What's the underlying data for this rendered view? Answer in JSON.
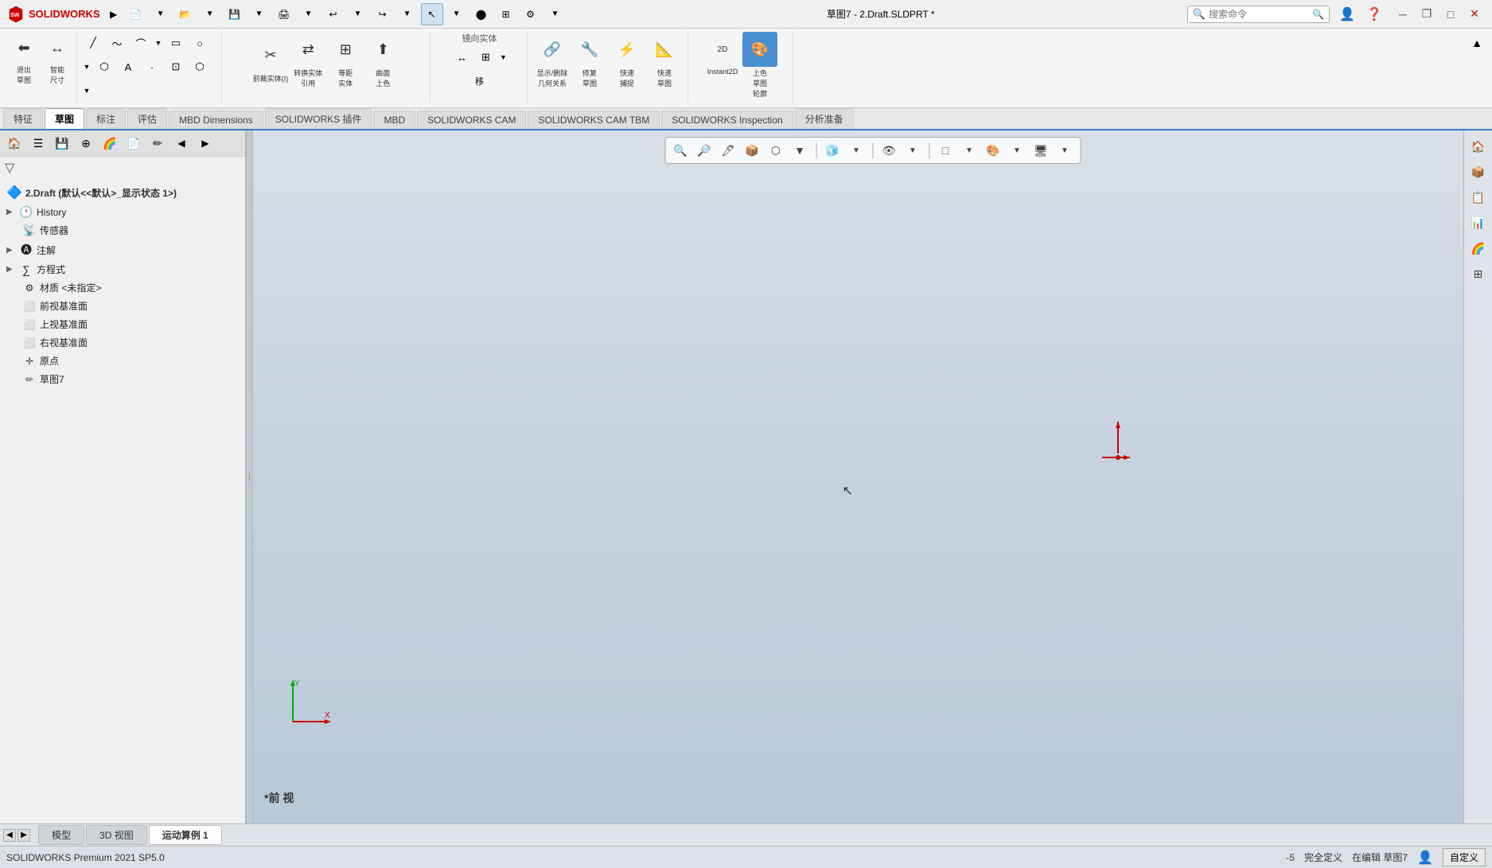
{
  "app": {
    "name": "SOLIDWORKS",
    "title": "草图7 - 2.Draft.SLDPRT *",
    "version": "SOLIDWORKS Premium 2021 SP5.0"
  },
  "titlebar": {
    "logo": "SW",
    "search_placeholder": "搜索命令",
    "window_buttons": [
      "minimize",
      "restore",
      "maximize",
      "close"
    ]
  },
  "toolbar": {
    "groups": [
      {
        "name": "sketch-exit",
        "buttons": [
          {
            "label": "退出草图",
            "icon": "⬅"
          },
          {
            "label": "智能尺寸",
            "icon": "↔"
          }
        ]
      }
    ],
    "mirror_label": "镜向实体",
    "convert_label": "转换实体引用",
    "crop_label": "前裁实体(I)",
    "trim_label": "等距实体",
    "surface_label": "曲面上色",
    "display_label": "显示/删除几何关系",
    "repair_label": "修复草图",
    "fast_capture_label": "快速捕捉",
    "fast_sketch_label": "快速草图",
    "instant2d_label": "Instant2D",
    "color_label": "上色草图轮廓"
  },
  "tabs": [
    {
      "label": "特征",
      "active": false
    },
    {
      "label": "草图",
      "active": true
    },
    {
      "label": "标注",
      "active": false
    },
    {
      "label": "评估",
      "active": false
    },
    {
      "label": "MBD Dimensions",
      "active": false
    },
    {
      "label": "SOLIDWORKS 插件",
      "active": false
    },
    {
      "label": "MBD",
      "active": false
    },
    {
      "label": "SOLIDWORKS CAM",
      "active": false
    },
    {
      "label": "SOLIDWORKS CAM TBM",
      "active": false
    },
    {
      "label": "SOLIDWORKS Inspection",
      "active": false
    },
    {
      "label": "分析准备",
      "active": false
    }
  ],
  "feature_tree": {
    "root": "2.Draft (默认<<默认>_显示状态 1>)",
    "items": [
      {
        "label": "History",
        "icon": "🕐",
        "has_arrow": true,
        "level": 1
      },
      {
        "label": "传感器",
        "icon": "📡",
        "has_arrow": false,
        "level": 1
      },
      {
        "label": "注解",
        "icon": "📝",
        "has_arrow": true,
        "level": 1
      },
      {
        "label": "方程式",
        "icon": "∑",
        "has_arrow": true,
        "level": 1
      },
      {
        "label": "材质 <未指定>",
        "icon": "⚙",
        "has_arrow": false,
        "level": 1
      },
      {
        "label": "前视基准面",
        "icon": "□",
        "has_arrow": false,
        "level": 1
      },
      {
        "label": "上视基准面",
        "icon": "□",
        "has_arrow": false,
        "level": 1
      },
      {
        "label": "右视基准面",
        "icon": "□",
        "has_arrow": false,
        "level": 1
      },
      {
        "label": "原点",
        "icon": "✛",
        "has_arrow": false,
        "level": 1
      },
      {
        "label": "草图7",
        "icon": "✏",
        "has_arrow": false,
        "level": 1
      }
    ]
  },
  "panel_toolbar": {
    "buttons": [
      "🏠",
      "📋",
      "💾",
      "⊕",
      "🌈",
      "📄",
      "✏",
      "◀",
      "▶"
    ]
  },
  "bottom_tabs": [
    {
      "label": "模型",
      "active": false
    },
    {
      "label": "3D 视图",
      "active": false
    },
    {
      "label": "运动算例 1",
      "active": true
    }
  ],
  "status_bar": {
    "software": "SOLIDWORKS Premium 2021 SP5.0",
    "coordinate": "-5",
    "status": "完全定义",
    "editing": "在编辑 草图7",
    "customize": "自定义"
  },
  "viewport": {
    "view_label": "*前 视",
    "axis_x": "X",
    "axis_y": "Y"
  }
}
